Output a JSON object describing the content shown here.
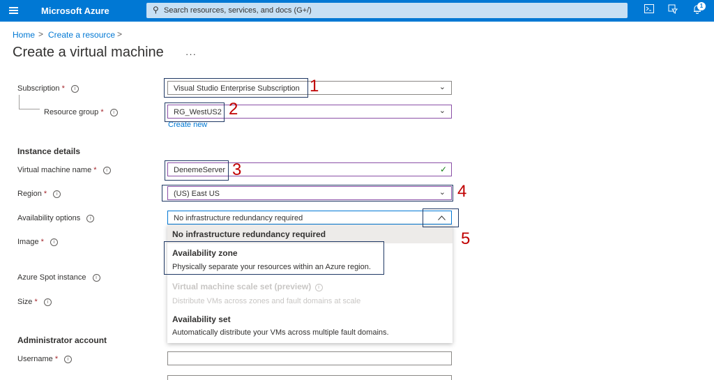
{
  "topbar": {
    "brand": "Microsoft Azure",
    "search_placeholder": "Search resources, services, and docs (G+/)",
    "notification_count": "1",
    "icons": [
      "menu-icon",
      "search-icon",
      "cloud-shell-icon",
      "directory-filter-icon",
      "notifications-icon"
    ]
  },
  "breadcrumb": {
    "home": "Home",
    "create": "Create a resource",
    "sep": ">"
  },
  "page": {
    "title": "Create a virtual machine",
    "more": "···"
  },
  "form": {
    "subscription": {
      "label": "Subscription",
      "value": "Visual Studio Enterprise Subscription"
    },
    "resource_group": {
      "label": "Resource group",
      "value": "RG_WestUS2",
      "create_new": "Create new"
    },
    "instance_details": "Instance details",
    "vm_name": {
      "label": "Virtual machine name",
      "value": "DenemeServer"
    },
    "region": {
      "label": "Region",
      "value": "(US) East US"
    },
    "availability": {
      "label": "Availability options",
      "value": "No infrastructure redundancy required"
    },
    "image": {
      "label": "Image"
    },
    "spot": {
      "label": "Azure Spot instance"
    },
    "size": {
      "label": "Size"
    },
    "admin_account": "Administrator account",
    "username": {
      "label": "Username",
      "value": ""
    },
    "required_mark": "*",
    "info_glyph": "i"
  },
  "dropdown": {
    "options": [
      {
        "title": "No infrastructure redundancy required",
        "desc": ""
      },
      {
        "title": "Availability zone",
        "desc": "Physically separate your resources within an Azure region."
      },
      {
        "title": "Virtual machine scale set (preview)",
        "desc": "Distribute VMs across zones and fault domains at scale"
      },
      {
        "title": "Availability set",
        "desc": "Automatically distribute your VMs across multiple fault domains."
      }
    ]
  },
  "annotations": [
    "1",
    "2",
    "3",
    "4",
    "5"
  ],
  "colors": {
    "azure_blue": "#0078d4",
    "annotation_red": "#c00000",
    "callout_navy": "#1f3864",
    "valid_green": "#107c10"
  }
}
